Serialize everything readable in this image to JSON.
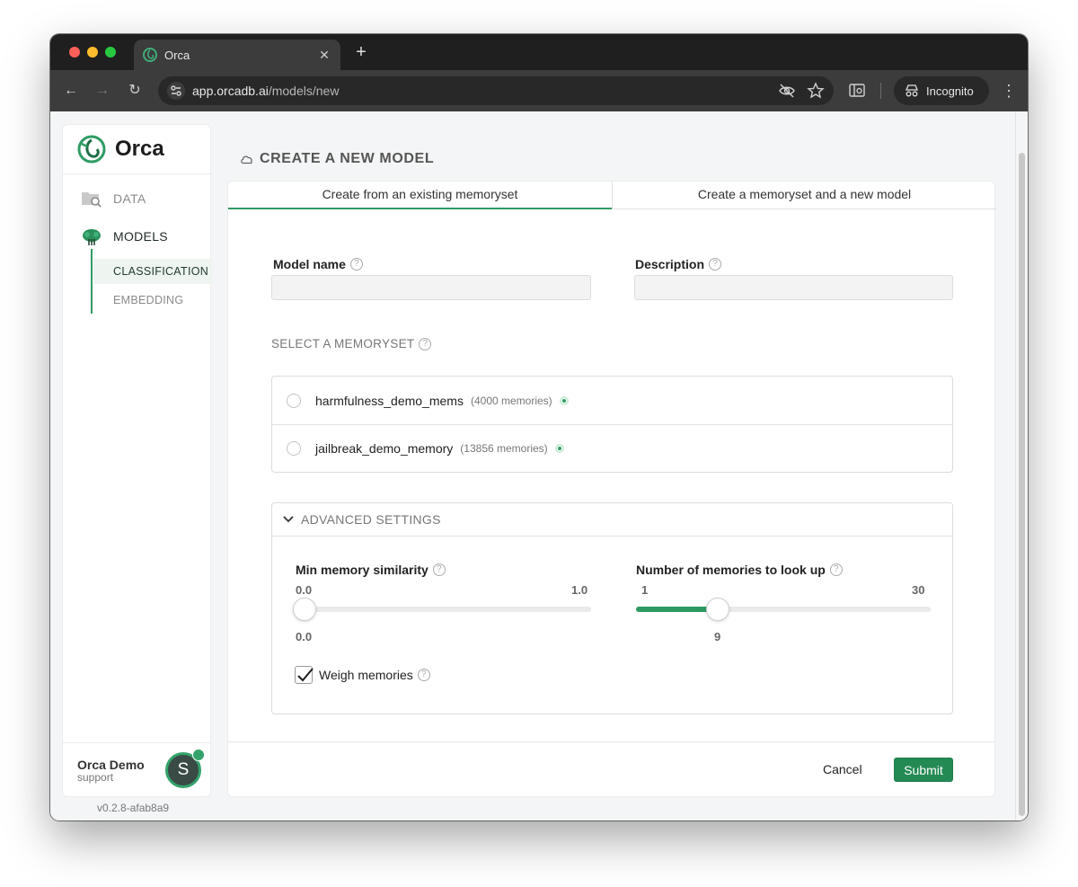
{
  "browser": {
    "tab_title": "Orca",
    "tab_close": "✕",
    "new_tab": "+",
    "url_host": "app.orcadb.ai",
    "url_path": "/models/new",
    "incognito_label": "Incognito"
  },
  "sidebar": {
    "brand": "Orca",
    "nav": [
      {
        "label": "DATA"
      },
      {
        "label": "MODELS"
      }
    ],
    "subnav": [
      {
        "label": "CLASSIFICATION"
      },
      {
        "label": "EMBEDDING"
      }
    ],
    "user": {
      "name": "Orca Demo",
      "role": "support",
      "initial": "S"
    },
    "version": "v0.2.8-afab8a9"
  },
  "page": {
    "title": "CREATE A NEW MODEL",
    "tabs": [
      {
        "label": "Create from an existing memoryset",
        "active": true
      },
      {
        "label": "Create a memoryset and a new model",
        "active": false
      }
    ],
    "fields": {
      "model_name_label": "Model name",
      "model_name_value": "",
      "description_label": "Description",
      "description_value": ""
    },
    "memoryset_section": "SELECT A MEMORYSET",
    "memorysets": [
      {
        "name": "harmfulness_demo_mems",
        "count": "(4000 memories)"
      },
      {
        "name": "jailbreak_demo_memory",
        "count": "(13856 memories)"
      }
    ],
    "advanced": {
      "title": "ADVANCED SETTINGS",
      "similarity": {
        "label": "Min memory similarity",
        "min": "0.0",
        "max": "1.0",
        "value": "0.0",
        "fraction": 0
      },
      "lookup": {
        "label": "Number of memories to look up",
        "min": "1",
        "max": "30",
        "value": "9",
        "fraction": 0.276
      },
      "weigh": {
        "label": "Weigh memories",
        "checked": true
      }
    },
    "actions": {
      "cancel": "Cancel",
      "submit": "Submit"
    }
  },
  "colors": {
    "accent": "#2f9b63",
    "submit": "#248a54"
  }
}
